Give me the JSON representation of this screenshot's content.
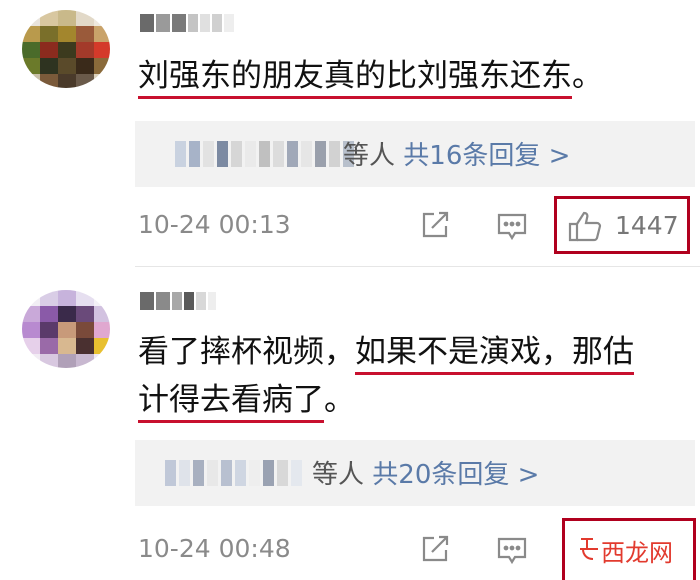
{
  "comments": [
    {
      "text_plain": "",
      "text_underlined": "刘强东的朋友真的比刘强东还东",
      "text_tail": "。",
      "reply_summary": {
        "who": "等人",
        "count": "共16条回复 >"
      },
      "time": "10-24 00:13",
      "likes": "1447"
    },
    {
      "line1_plain": "看了摔杯视频，",
      "line1_underlined": "如果不是演戏，那估",
      "line2_underlined": "计得去看病了",
      "line2_tail": "。",
      "reply_summary": {
        "who": "等人",
        "count": "共20条回复 >"
      },
      "time": "10-24 00:48",
      "likes": ""
    }
  ],
  "watermark": {
    "text": "西龙网",
    "icon": "watermark-logo-icon"
  },
  "icons": {
    "share": "share-icon",
    "comment": "comment-icon",
    "like": "thumbs-up-icon"
  },
  "colors": {
    "underline": "#c8102e",
    "highlight_box": "#b0001e",
    "link": "#5a7aa8",
    "watermark": "#e23a2e",
    "reply_bg": "#f2f2f2"
  }
}
